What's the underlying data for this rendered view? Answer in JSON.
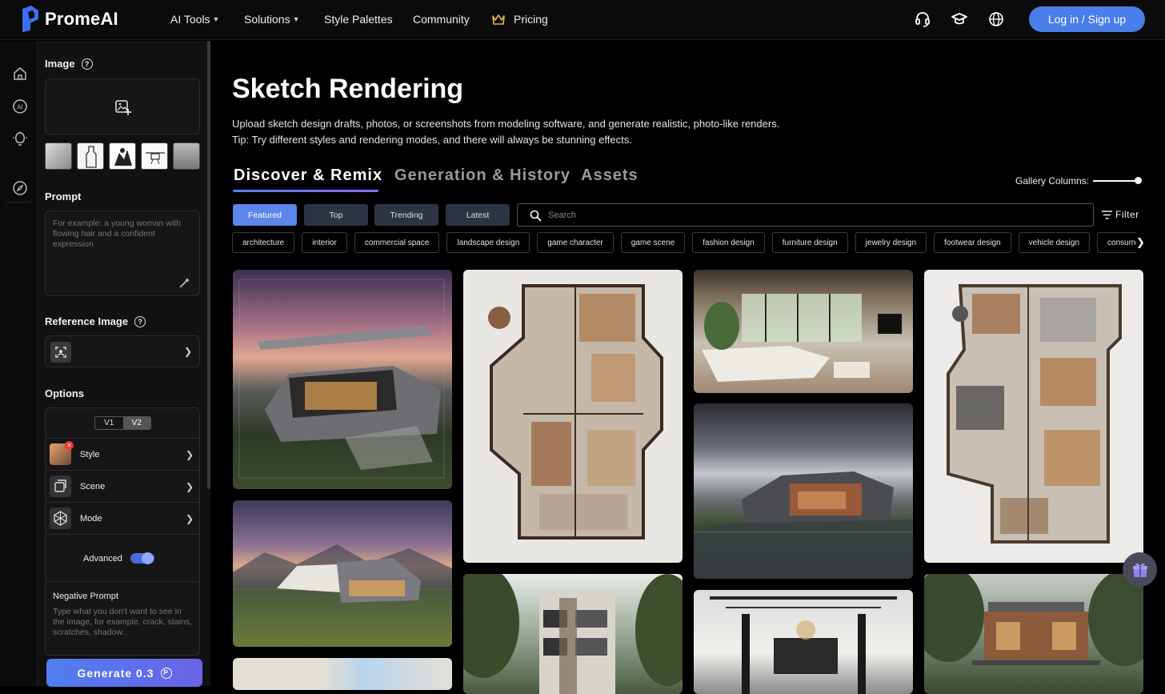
{
  "brand": {
    "name": "PromeAI",
    "color": "#3a6ff0"
  },
  "nav": {
    "ai_tools": "AI Tools",
    "solutions": "Solutions",
    "style_palettes": "Style Palettes",
    "community": "Community",
    "pricing": "Pricing",
    "login": "Log in / Sign up"
  },
  "icons": {
    "rail": [
      "home-icon",
      "ai-icon",
      "lightbulb-icon",
      "compass-icon"
    ],
    "top": [
      "headset-icon",
      "graduation-cap-icon",
      "globe-icon"
    ]
  },
  "panel": {
    "image_label": "Image",
    "prompt_label": "Prompt",
    "prompt_placeholder": "For example: a young woman with flowing hair and a confident expression",
    "reference_label": "Reference Image",
    "options_label": "Options",
    "version_v1": "V1",
    "version_v2": "V2",
    "selected_version": "V2",
    "style_label": "Style",
    "scene_label": "Scene",
    "mode_label": "Mode",
    "advanced_label": "Advanced",
    "advanced_on": true,
    "negative_label": "Negative Prompt",
    "negative_placeholder": "Type what you don't want to see in the image, for example. crack, stains, scratches, shadow..",
    "generate_label": "Generate 0.3"
  },
  "main": {
    "title": "Sketch Rendering",
    "desc_line1": "Upload sketch design drafts, photos, or screenshots from modeling software, and generate realistic, photo-like renders.",
    "desc_line2": "Tip: Try different styles and rendering modes, and there will always be stunning effects.",
    "tabs": [
      "Discover & Remix",
      "Generation & History",
      "Assets"
    ],
    "active_tab": "Discover & Remix",
    "gallery_columns_label": "Gallery Columns:",
    "filters": [
      "Featured",
      "Top",
      "Trending",
      "Latest"
    ],
    "active_filter": "Featured",
    "search_placeholder": "Search",
    "filter_label": "Filter",
    "tags": [
      "architecture",
      "interior",
      "commercial space",
      "landscape design",
      "game character",
      "game scene",
      "fashion design",
      "furniture design",
      "jewelry design",
      "footwear design",
      "vehicle design",
      "consumer"
    ]
  }
}
